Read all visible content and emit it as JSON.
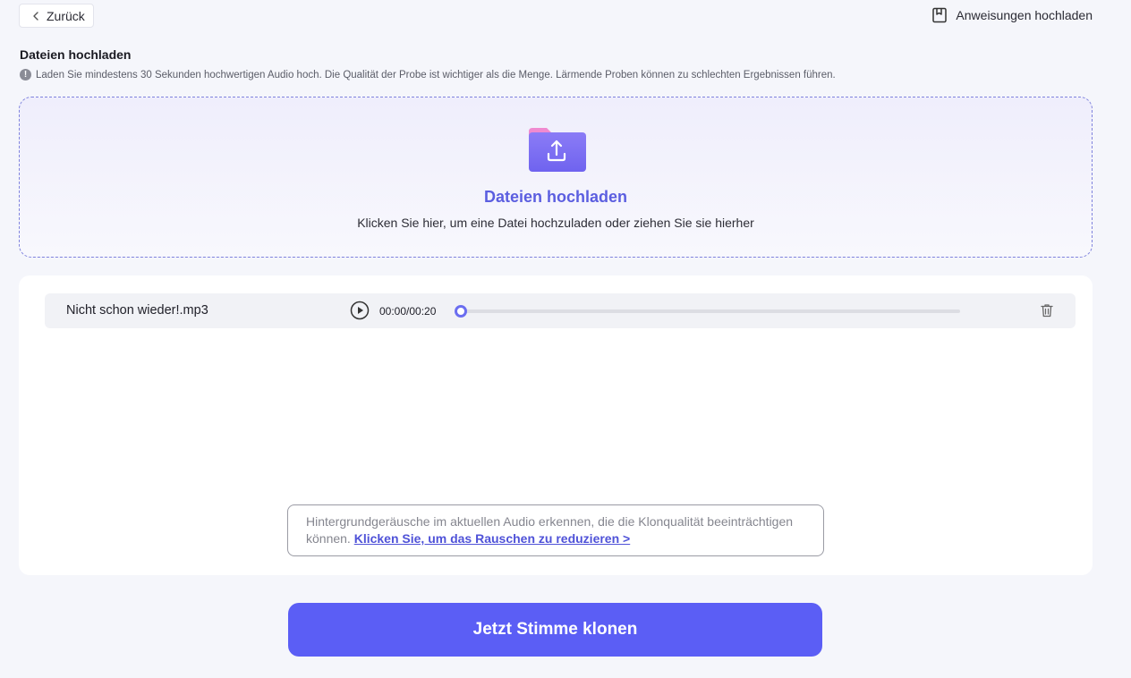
{
  "topbar": {
    "back_label": "Zurück",
    "instructions_label": "Anweisungen hochladen"
  },
  "section": {
    "title": "Dateien hochladen",
    "hint": "Laden Sie mindestens 30 Sekunden hochwertigen Audio hoch. Die Qualität der Probe ist wichtiger als die Menge. Lärmende Proben können zu schlechten Ergebnissen führen."
  },
  "dropzone": {
    "icon": "folder-upload-icon",
    "title": "Dateien hochladen",
    "subtitle": "Klicken Sie hier, um eine Datei hochzuladen oder ziehen Sie sie hierher"
  },
  "files": [
    {
      "name": "Nicht schon wieder!.mp3",
      "time": "00:00/00:20",
      "progress": 0
    }
  ],
  "noise_notice": {
    "text": "Hintergrundgeräusche im aktuellen Audio erkennen, die die Klonqualität beeinträchtigen können.",
    "link": "Klicken Sie, um das Rauschen zu reduzieren >"
  },
  "clone_button": "Jetzt Stimme klonen",
  "colors": {
    "accent": "#5b5ef5",
    "accent_text": "#5b5ee0",
    "background": "#f5f6fb"
  }
}
